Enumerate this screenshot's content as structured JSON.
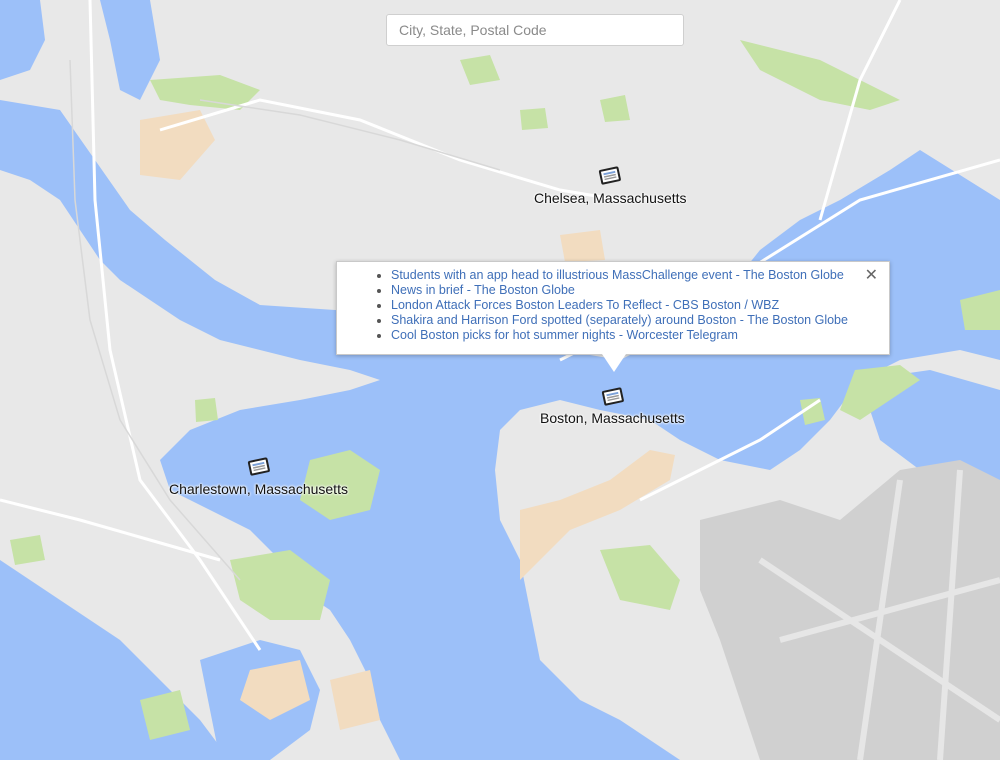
{
  "search": {
    "placeholder": "City, State, Postal Code",
    "value": ""
  },
  "colors": {
    "water": "#9cc0f9",
    "land": "#e8e8e8",
    "park": "#c6e2a6",
    "urban": "#f2dcc0",
    "road": "#ffffff",
    "airport": "#d0d0d0"
  },
  "places": [
    {
      "name": "Chelsea, Massachusetts",
      "icon": "newspaper-icon"
    },
    {
      "name": "Boston, Massachusetts",
      "icon": "newspaper-icon"
    },
    {
      "name": "Charlestown, Massachusetts",
      "icon": "newspaper-icon"
    }
  ],
  "popup": {
    "close_symbol": "✕",
    "items": [
      "Students with an app head to illustrious MassChallenge event - The Boston Globe",
      "News in brief - The Boston Globe",
      "London Attack Forces Boston Leaders To Reflect - CBS Boston / WBZ",
      "Shakira and Harrison Ford spotted (separately) around Boston - The Boston Globe",
      "Cool Boston picks for hot summer nights - Worcester Telegram"
    ]
  }
}
